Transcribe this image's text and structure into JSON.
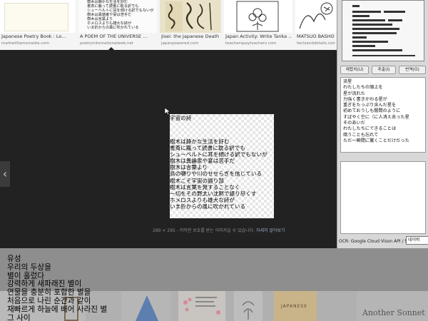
{
  "thumbnails": [
    {
      "caption": "Japanese Poetry Book : Lo...",
      "source": "markwilliamsmedia.com"
    },
    {
      "caption": "A POEM OF THE UNIVERSE ...",
      "source": "poetryinternationalweb.net"
    },
    {
      "caption": "Jisei: the Japanese Death ...",
      "source": "japanpowered.com"
    },
    {
      "caption": "Japan Activity: Write Tanka ...",
      "source": "teacherspayteachers.com"
    },
    {
      "caption": "MATSUO BASHO ...",
      "source": "factsanddetails.com"
    }
  ],
  "thumb_small_text": [
    "樹木は静かな生活を好む",
    "書斎に籠って読書に耽る訳でも",
    "シューベルトに耳を傾ける訳でもないが",
    "樹木は異端者や宴は苦手だ",
    "樹木は言葉より",
    "ホメロスよりも雄大な詩が",
    "いま折からの風に吹かれている"
  ],
  "viewer": {
    "title": "宇宙の詩",
    "lines": [
      "樹木は静かな生活を好む",
      "書斎に籠って読書に耽る訳でも",
      "シューベルトに耳を傾ける訳でもないが",
      "樹木は異論家や宴は苦手だ",
      "樹木は言葉より",
      "鳥の囀りや川のせせらぎを信じている",
      "樹木こそ宇宙の語り部",
      "樹木は言葉を発することなく",
      "一切をその野太い沈黙で語り尽くす",
      "ホメロスよりも雄大な詩が",
      "いま折からの風に吹かれている"
    ],
    "info": "289 × 295 - 저작권 보호를 받는 이미지일 수 있습니다.",
    "info_link": "자세히 알아보기",
    "prev_arrow": "‹"
  },
  "ocr": {
    "buttons": [
      "재합치(U)",
      "추출(I)",
      "번역(O)"
    ],
    "text_lines": [
      "流星",
      "わたしたちの頭上を",
      "星が流れた",
      "力強く書きかわる星が",
      "重ぎをたっぷり含んだ星を",
      "初めておうしも闇間のように",
      "すばやく空に（に人消え去った星",
      "そのあいだ",
      "わたしたちにできることは",
      "錯うことも忘れて",
      "ただ一瞬間に驚くことだけだった"
    ],
    "footer": "OCR: Google Cloud Vison API / 번역:",
    "lang": "네이버"
  },
  "korean_overlay": [
    "유성",
    "우리의 두상을",
    "별이 흘렀다",
    "강력하게 새파래진 별이",
    "연물을 충분히 포함한 별을",
    "처음으로 나린 순간과 같이",
    "재빠르게 하늘에 배어 사라진 별",
    "그 사이"
  ],
  "bottom_thumbs": {
    "sample_text": "Another Sonnet",
    "japanese": "JAPANESE"
  },
  "colors": {
    "viewer_bg": "#222222",
    "panel_bg": "#d8d8d8",
    "bottom_bg": "#8e8e8e",
    "link": "#9aa8c8"
  }
}
